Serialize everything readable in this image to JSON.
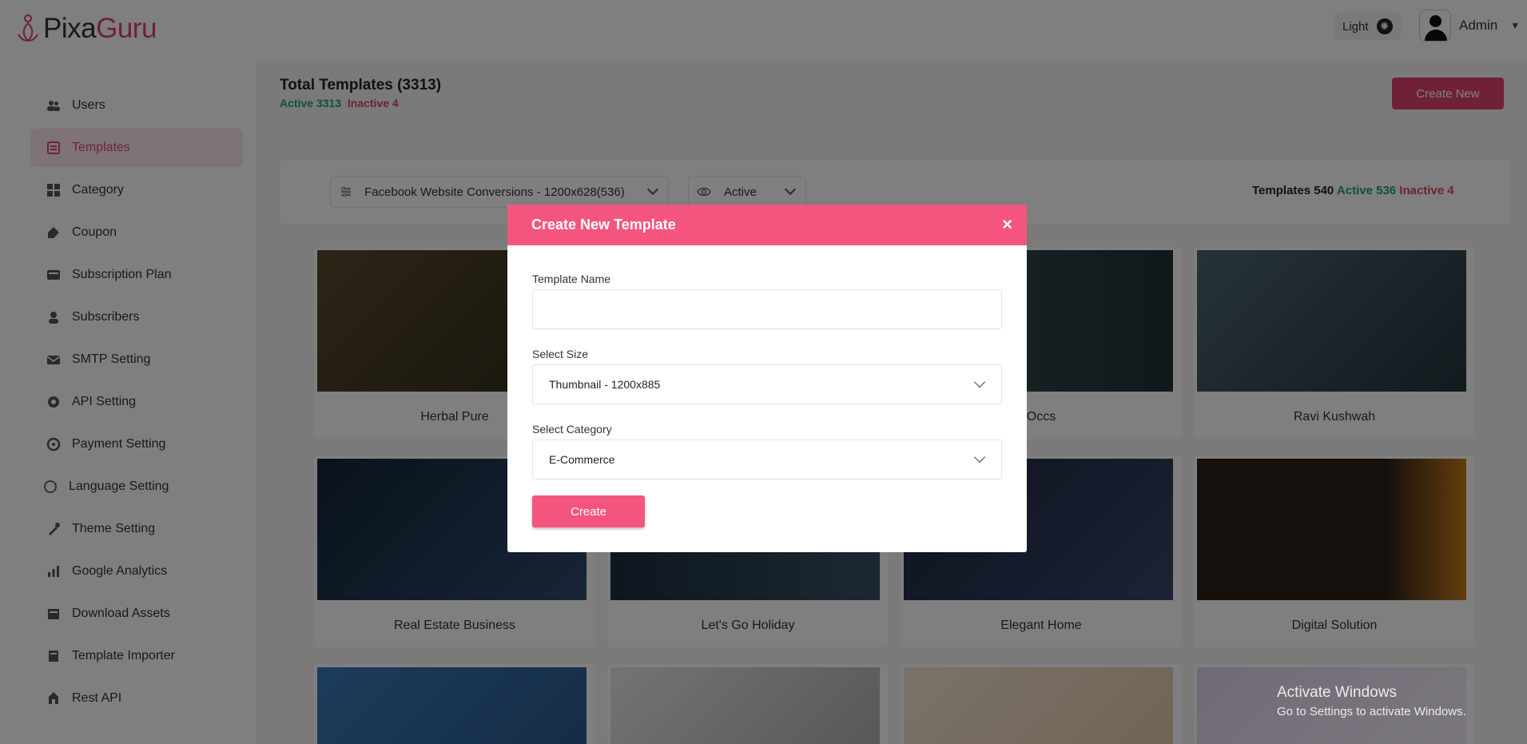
{
  "brand": {
    "name_part1": "Pixa",
    "name_part2": "Guru"
  },
  "header": {
    "theme_label": "Light",
    "user_name": "Admin"
  },
  "sidebar": {
    "items": [
      {
        "label": "Users",
        "icon": "users-icon"
      },
      {
        "label": "Templates",
        "icon": "templates-icon",
        "active": true
      },
      {
        "label": "Category",
        "icon": "category-icon"
      },
      {
        "label": "Coupon",
        "icon": "coupon-icon"
      },
      {
        "label": "Subscription Plan",
        "icon": "subscription-icon"
      },
      {
        "label": "Subscribers",
        "icon": "subscribers-icon"
      },
      {
        "label": "SMTP Setting",
        "icon": "mail-icon"
      },
      {
        "label": "API Setting",
        "icon": "api-icon"
      },
      {
        "label": "Payment Setting",
        "icon": "payment-icon"
      },
      {
        "label": "Language Setting",
        "icon": "language-icon"
      },
      {
        "label": "Theme Setting",
        "icon": "theme-icon"
      },
      {
        "label": "Google Analytics",
        "icon": "analytics-icon"
      },
      {
        "label": "Download Assets",
        "icon": "download-icon"
      },
      {
        "label": "Template Importer",
        "icon": "importer-icon"
      },
      {
        "label": "Rest API",
        "icon": "rest-api-icon"
      }
    ]
  },
  "main": {
    "title": "Total Templates (3313)",
    "active_label": "Active 3313",
    "inactive_label": "Inactive 4",
    "create_new_label": "Create New",
    "size_filter": "Facebook Website Conversions - 1200x628(536)",
    "status_filter": "Active",
    "counts": {
      "templates": "Templates 540",
      "active": "Active 536",
      "inactive": "Inactive 4"
    },
    "cards": [
      {
        "name": "Herbal Pure",
        "color": "#3e3a2a"
      },
      {
        "name": "Occs",
        "color": "#2b3b3f"
      },
      {
        "name": "Ravi Kushwah",
        "color": "#3a4e58"
      },
      {
        "name": "Real Estate Business",
        "color": "#14253b"
      },
      {
        "name": "Let's Go Holiday",
        "color": "#1c2d3f"
      },
      {
        "name": "Elegant Home",
        "color": "#1a2440"
      },
      {
        "name": "Digital Solution",
        "color": "#2a2018"
      },
      {
        "name": "",
        "color": "#3a78b6"
      },
      {
        "name": "",
        "color": "#c9c9c9"
      },
      {
        "name": "",
        "color": "#efe1cf"
      },
      {
        "name": "",
        "color": "#d9cbe5"
      }
    ]
  },
  "modal": {
    "title": "Create New Template",
    "template_name_label": "Template Name",
    "template_name_value": "",
    "size_label": "Select Size",
    "size_value": "Thumbnail - 1200x885",
    "category_label": "Select Category",
    "category_value": "E-Commerce",
    "create_label": "Create",
    "close_glyph": "×"
  },
  "watermark": {
    "line1": "Activate Windows",
    "line2": "Go to Settings to activate Windows."
  },
  "colors": {
    "accent": "#e2436f",
    "modal_header": "#f4557f",
    "active_green": "#1fa36b",
    "inactive_red": "#e0445d"
  }
}
